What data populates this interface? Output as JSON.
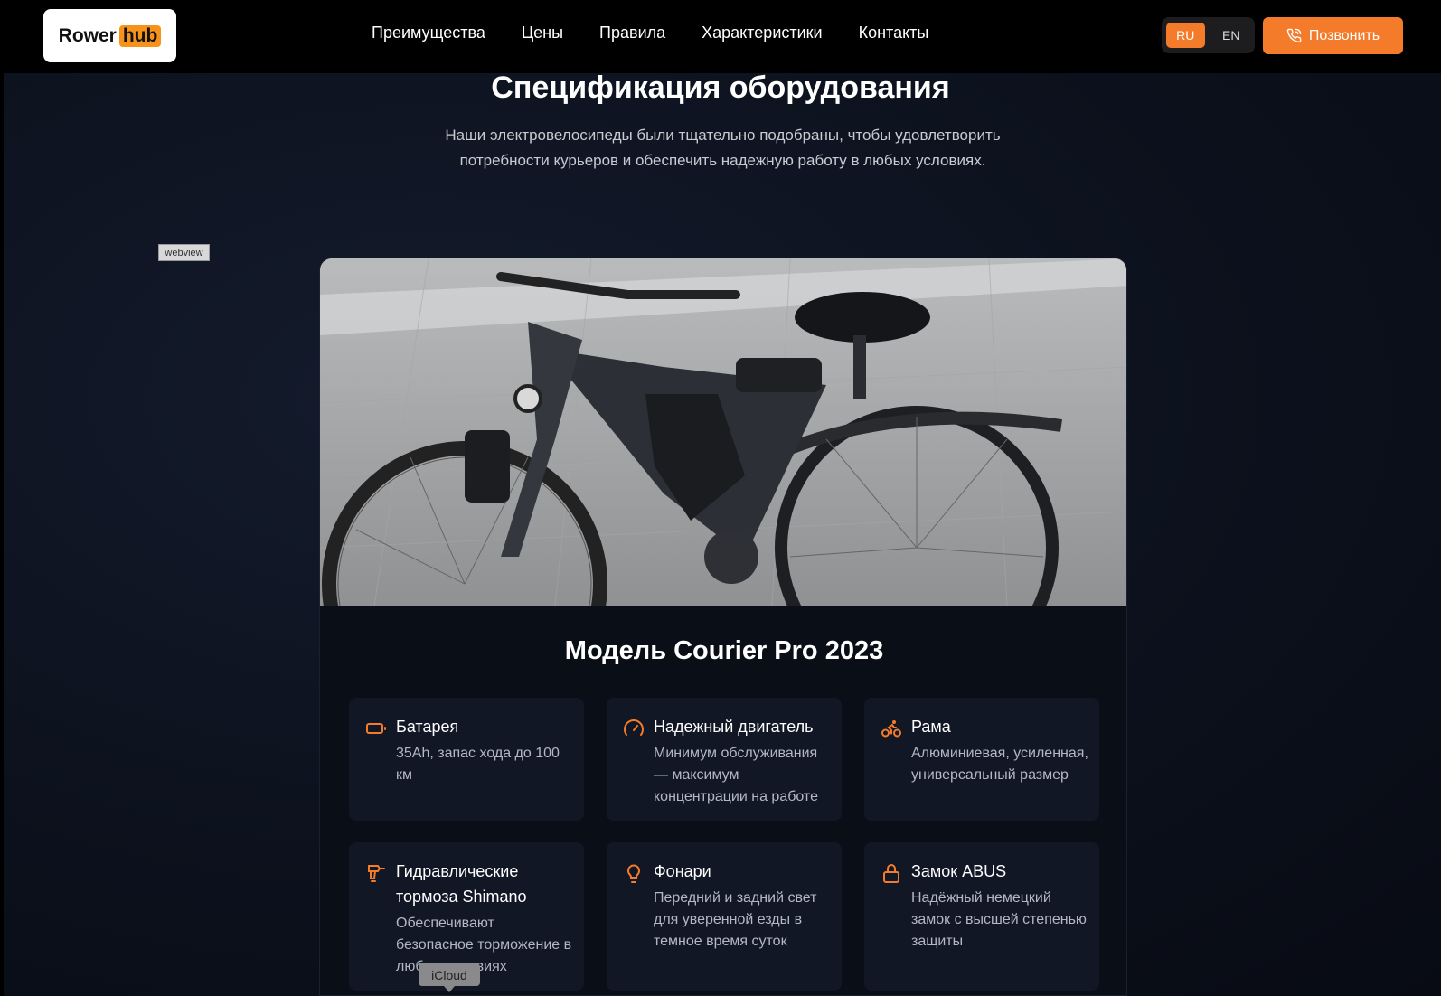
{
  "header": {
    "logo_text_a": "Rower",
    "logo_text_b": "hub",
    "nav": [
      "Преимущества",
      "Цены",
      "Правила",
      "Характеристики",
      "Контакты"
    ],
    "lang_ru": "RU",
    "lang_en": "EN",
    "call_label": "Позвонить"
  },
  "section": {
    "title": "Спецификация оборудования",
    "subtitle": "Наши электровелосипеды были тщательно подобраны, чтобы удовлетворить потребности курьеров и обеспечить надежную работу в любых условиях."
  },
  "overlay": {
    "webview": "webview",
    "icloud": "iCloud"
  },
  "card": {
    "model_title": "Модель Courier Pro 2023",
    "features": [
      {
        "title": "Батарея",
        "desc": "35Ah, запас хода до 100 км",
        "icon": "battery-icon"
      },
      {
        "title": "Надежный двигатель",
        "desc": "Минимум обслуживания — максимум концентрации на работе",
        "icon": "gauge-icon"
      },
      {
        "title": "Рама",
        "desc": "Алюминиевая, усиленная, универсальный размер",
        "icon": "bike-icon"
      },
      {
        "title": "Гидравлические тормоза Shimano",
        "desc": "Обеспечивают безопасное торможение в любых условиях",
        "icon": "drill-icon"
      },
      {
        "title": "Фонари",
        "desc": "Передний и задний свет для уверенной езды в темное время суток",
        "icon": "lightbulb-icon"
      },
      {
        "title": "Замок ABUS",
        "desc": "Надёжный немецкий замок с высшей степенью защиты",
        "icon": "lock-icon"
      }
    ]
  },
  "colors": {
    "accent": "#f47b2a",
    "background": "#0c111d",
    "card": "#111725"
  }
}
